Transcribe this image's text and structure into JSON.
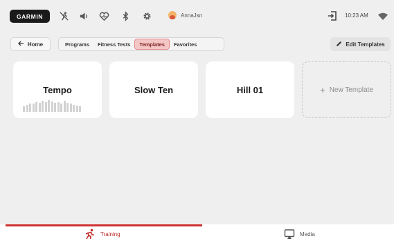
{
  "status_bar": {
    "logo": "GARMIN",
    "user": "AnnaJsn",
    "time": "10:23 AM",
    "icons": [
      "no-run-icon",
      "speaker-icon",
      "heart-icon",
      "bluetooth-icon",
      "gear-icon",
      "avatar-icon",
      "exit-icon",
      "wifi-icon"
    ]
  },
  "nav": {
    "home_label": "Home",
    "tabs": [
      {
        "label": "Programs",
        "active": false
      },
      {
        "label": "Fitness Tests",
        "active": false
      },
      {
        "label": "Templates",
        "active": true
      },
      {
        "label": "Favorites",
        "active": false
      }
    ],
    "edit_label": "Edit Templates"
  },
  "templates": [
    {
      "name": "Tempo",
      "has_profile": true
    },
    {
      "name": "Slow Ten",
      "has_profile": false
    },
    {
      "name": "Hill 01",
      "has_profile": false
    }
  ],
  "new_template_label": "New Template",
  "bottom_tabs": [
    {
      "label": "Training",
      "icon": "runner-icon",
      "active": true
    },
    {
      "label": "Media",
      "icon": "media-icon",
      "active": false
    }
  ],
  "colors": {
    "accent": "#d02f2f",
    "tab_active_bg": "#f4c6c6",
    "background": "#efefef"
  }
}
